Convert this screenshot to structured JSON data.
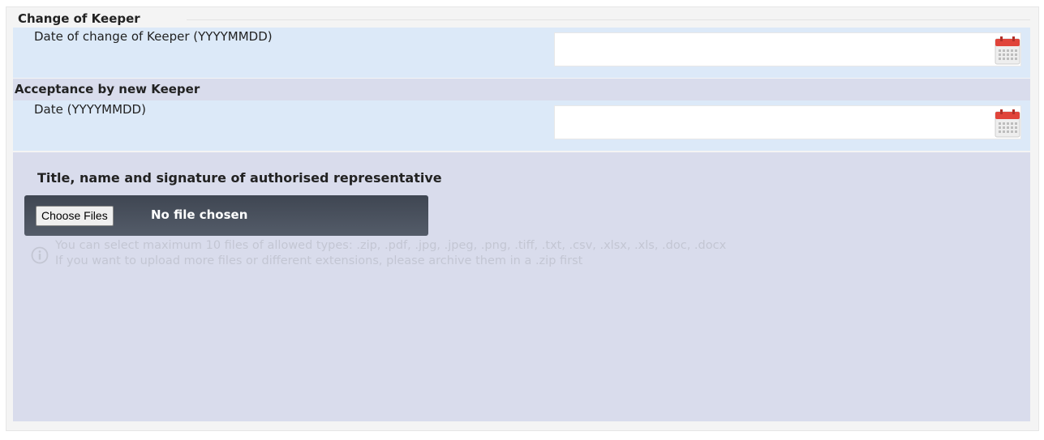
{
  "change_of_keeper": {
    "legend": "Change of Keeper",
    "date_label": "Date of change of Keeper (YYYYMMDD)",
    "date_value": "",
    "calendar_icon": "calendar-icon"
  },
  "acceptance": {
    "header": "Acceptance by new Keeper",
    "date_label": "Date (YYYYMMDD)",
    "date_value": "",
    "calendar_icon": "calendar-icon"
  },
  "upload": {
    "title": "Title, name and signature of authorised representative",
    "choose_button": "Choose Files",
    "status": "No file chosen",
    "info_icon": "info-icon",
    "hint_line1": "You can select maximum 10 files of allowed types: .zip, .pdf, .jpg, .jpeg, .png, .tiff, .txt, .csv, .xlsx, .xls, .doc, .docx",
    "hint_line2": "If you want to upload more files or different extensions, please archive them in a .zip first"
  },
  "colors": {
    "field_row_bg": "#dce9f8",
    "section_bg": "#d9dcec",
    "file_box_bg": "#4a515d",
    "calendar_red": "#e0443a"
  }
}
